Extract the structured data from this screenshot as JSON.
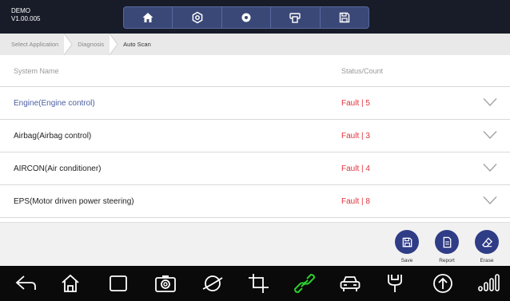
{
  "header": {
    "device_name": "DEMO",
    "version": "V1.00.005",
    "toolbar_icons": [
      "home-icon",
      "settings-icon",
      "record-icon",
      "print-icon",
      "save-icon"
    ]
  },
  "breadcrumb": {
    "items": [
      "Select Application",
      "Diagnosis",
      "Auto Scan"
    ]
  },
  "table": {
    "col_name": "System Name",
    "col_status": "Status/Count",
    "rows": [
      {
        "name": "Engine(Engine control)",
        "status": "Fault | 5"
      },
      {
        "name": "Airbag(Airbag control)",
        "status": "Fault | 3"
      },
      {
        "name": "AIRCON(Air conditioner)",
        "status": "Fault | 4"
      },
      {
        "name": "EPS(Motor driven power steering)",
        "status": "Fault | 8"
      }
    ]
  },
  "actions": {
    "save": "Save",
    "report": "Report",
    "erase": "Erase"
  },
  "navbar_icons": [
    "back-icon",
    "home-icon",
    "recent-apps-icon",
    "camera-icon",
    "browser-icon",
    "crop-icon",
    "link-icon",
    "car-icon",
    "diagnostic-connector-icon",
    "upload-icon",
    "signal-bars-icon"
  ],
  "colors": {
    "header_bg": "#181c29",
    "toolbar_bg": "#3a4877",
    "fault_red": "#e0333a",
    "selected_blue": "#4a5fa0",
    "action_blue": "#2f3c86",
    "link_green": "#2bd02b"
  }
}
